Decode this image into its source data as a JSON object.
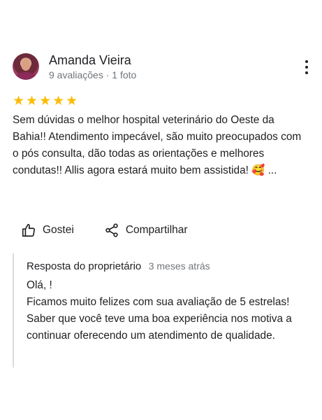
{
  "reviewer": {
    "name": "Amanda Vieira",
    "meta": "9 avaliações · 1 foto"
  },
  "review": {
    "rating": 5,
    "stars": "★★★★★",
    "text": "Sem dúvidas o melhor hospital veterinário do Oeste da Bahia!! Atendimento impecável, são muito preocupados com o pós consulta, dão todas as orientações e melhores condutas!! Allis agora estará muito bem assistida! 🥰 ..."
  },
  "actions": {
    "like_label": "Gostei",
    "share_label": "Compartilhar"
  },
  "owner_reply": {
    "title": "Resposta do proprietário",
    "date": "3 meses atrás",
    "text": "Olá, !\n Ficamos muito felizes com sua avaliação de 5 estrelas! Saber que você teve uma boa experiência nos motiva a continuar oferecendo um atendimento de qualidade."
  },
  "icons": {
    "more": "more-vert-icon",
    "like": "thumb-up-icon",
    "share": "share-icon"
  },
  "colors": {
    "star": "#fbbc04",
    "secondary_text": "#70757a",
    "divider": "#dadce0"
  }
}
